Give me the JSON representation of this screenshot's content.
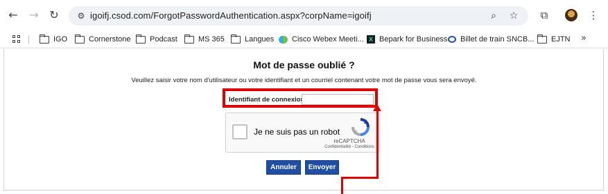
{
  "browser": {
    "url": "igoifj.csod.com/ForgotPasswordAuthentication.aspx?corpName=igoifj",
    "nav": {
      "back_glyph": "←",
      "forward_glyph": "→",
      "reload_glyph": "↻"
    },
    "icons": [
      "back-icon",
      "forward-icon",
      "reload-icon",
      "site-info-icon",
      "zoom-icon",
      "star-icon",
      "extensions-icon",
      "avatar",
      "kebab-menu-icon"
    ]
  },
  "bookmarks": {
    "items": [
      {
        "label": "IGO",
        "icon": "folder-icon"
      },
      {
        "label": "Cornerstone",
        "icon": "folder-icon"
      },
      {
        "label": "Podcast",
        "icon": "folder-icon"
      },
      {
        "label": "MS 365",
        "icon": "folder-icon"
      },
      {
        "label": "Langues",
        "icon": "folder-icon"
      },
      {
        "label": "Cisco Webex Meeti...",
        "icon": "webex-icon"
      },
      {
        "label": "Bepark for Business",
        "icon": "bepark-icon"
      },
      {
        "label": "Billet de train SNCB...",
        "icon": "sncb-icon"
      },
      {
        "label": "EJTN",
        "icon": "folder-icon"
      }
    ],
    "more_glyph": "»"
  },
  "page": {
    "title": "Mot de passe oublié ?",
    "instructions": "Veuillez saisir votre nom d'utilisateur ou votre identifiant et un courriel contenant votre mot de passe vous sera envoyé.",
    "login_label": "Identifiant de connexion",
    "login_value": "",
    "captcha": {
      "label": "Je ne suis pas un robot",
      "brand": "reCAPTCHA",
      "links": "Confidentialité - Conditions"
    },
    "buttons": {
      "cancel": "Annuler",
      "send": "Envoyer"
    }
  },
  "colors": {
    "annotation": "#e00000",
    "button": "#1f4ea3"
  }
}
